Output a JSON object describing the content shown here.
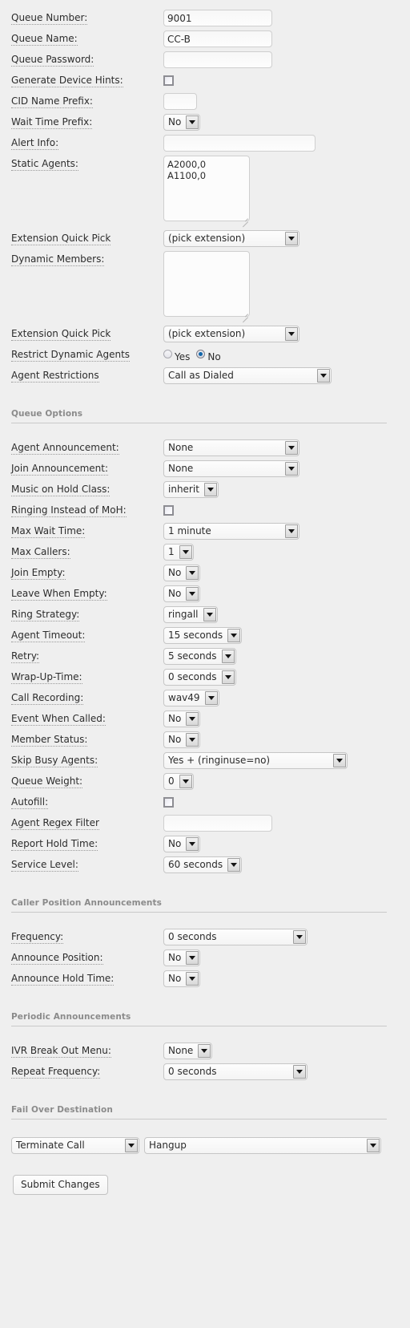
{
  "top_fields": [
    {
      "label": "Queue Number:",
      "type": "text",
      "value": "9001",
      "width": "w-med"
    },
    {
      "label": "Queue Name:",
      "type": "text",
      "value": "CC-B",
      "width": "w-med"
    },
    {
      "label": "Queue Password:",
      "type": "text",
      "value": "",
      "width": "w-med"
    },
    {
      "label": "Generate Device Hints:",
      "type": "checkbox",
      "checked": false
    },
    {
      "label": "CID Name Prefix:",
      "type": "text",
      "value": "",
      "width": "w-sm"
    },
    {
      "label": "Wait Time Prefix:",
      "type": "select",
      "value": "No",
      "width": "w-auto"
    },
    {
      "label": "Alert Info:",
      "type": "text",
      "value": "",
      "width": "w-lg"
    }
  ],
  "static_agents": {
    "label": "Static Agents:",
    "value": "A2000,0\nA1100,0"
  },
  "extension_quick_pick_1": {
    "label": "Extension Quick Pick",
    "value": "(pick extension)"
  },
  "dynamic_members": {
    "label": "Dynamic Members:",
    "value": ""
  },
  "extension_quick_pick_2": {
    "label": "Extension Quick Pick",
    "value": "(pick extension)"
  },
  "restrict_dynamic_agents": {
    "label": "Restrict Dynamic Agents",
    "options": [
      {
        "label": "Yes",
        "selected": false
      },
      {
        "label": "No",
        "selected": true
      }
    ]
  },
  "agent_restrictions": {
    "label": "Agent Restrictions",
    "value": "Call as Dialed"
  },
  "sections": {
    "queue_options": "Queue Options",
    "caller_position": "Caller Position Announcements",
    "periodic": "Periodic Announcements",
    "failover": "Fail Over Destination"
  },
  "queue_options_fields": [
    {
      "label": "Agent Announcement:",
      "type": "select",
      "value": "None",
      "width": "w-170"
    },
    {
      "label": "Join Announcement:",
      "type": "select",
      "value": "None",
      "width": "w-170"
    },
    {
      "label": "Music on Hold Class:",
      "type": "select",
      "value": "inherit",
      "width": "w-auto"
    },
    {
      "label": "Ringing Instead of MoH:",
      "type": "checkbox",
      "checked": false
    },
    {
      "label": "Max Wait Time:",
      "type": "select",
      "value": "1 minute",
      "width": "w-170"
    },
    {
      "label": "Max Callers:",
      "type": "select",
      "value": "1",
      "width": "w-auto"
    },
    {
      "label": "Join Empty:",
      "type": "select",
      "value": "No",
      "width": "w-auto"
    },
    {
      "label": "Leave When Empty:",
      "type": "select",
      "value": "No",
      "width": "w-auto"
    },
    {
      "label": "Ring Strategy:",
      "type": "select",
      "value": "ringall",
      "width": "w-auto"
    },
    {
      "label": "Agent Timeout:",
      "type": "select",
      "value": "15 seconds",
      "width": "w-auto"
    },
    {
      "label": "Retry:",
      "type": "select",
      "value": "5 seconds",
      "width": "w-auto"
    },
    {
      "label": "Wrap-Up-Time:",
      "type": "select",
      "value": "0 seconds",
      "width": "w-auto"
    },
    {
      "label": "Call Recording:",
      "type": "select",
      "value": "wav49",
      "width": "w-auto"
    },
    {
      "label": "Event When Called:",
      "type": "select",
      "value": "No",
      "width": "w-auto"
    },
    {
      "label": "Member Status:",
      "type": "select",
      "value": "No",
      "width": "w-auto"
    },
    {
      "label": "Skip Busy Agents:",
      "type": "select",
      "value": "Yes + (ringinuse=no)",
      "width": "w-230"
    },
    {
      "label": "Queue Weight:",
      "type": "select",
      "value": "0",
      "width": "w-auto"
    },
    {
      "label": "Autofill:",
      "type": "checkbox",
      "checked": false
    },
    {
      "label": "Agent Regex Filter",
      "type": "text",
      "value": "",
      "width": "w-med"
    },
    {
      "label": "Report Hold Time:",
      "type": "select",
      "value": "No",
      "width": "w-auto"
    },
    {
      "label": "Service Level:",
      "type": "select",
      "value": "60 seconds",
      "width": "w-auto"
    }
  ],
  "caller_position_fields": [
    {
      "label": "Frequency:",
      "type": "select",
      "value": "0 seconds",
      "width": "w-180"
    },
    {
      "label": "Announce Position:",
      "type": "select",
      "value": "No",
      "width": "w-auto"
    },
    {
      "label": "Announce Hold Time:",
      "type": "select",
      "value": "No",
      "width": "w-auto"
    }
  ],
  "periodic_fields": [
    {
      "label": "IVR Break Out Menu:",
      "type": "select",
      "value": "None",
      "width": "w-auto"
    },
    {
      "label": "Repeat Frequency:",
      "type": "select",
      "value": "0 seconds",
      "width": "w-180"
    }
  ],
  "failover": {
    "destination_type": "Terminate Call",
    "destination_target": "Hangup"
  },
  "submit": {
    "label": "Submit Changes"
  }
}
